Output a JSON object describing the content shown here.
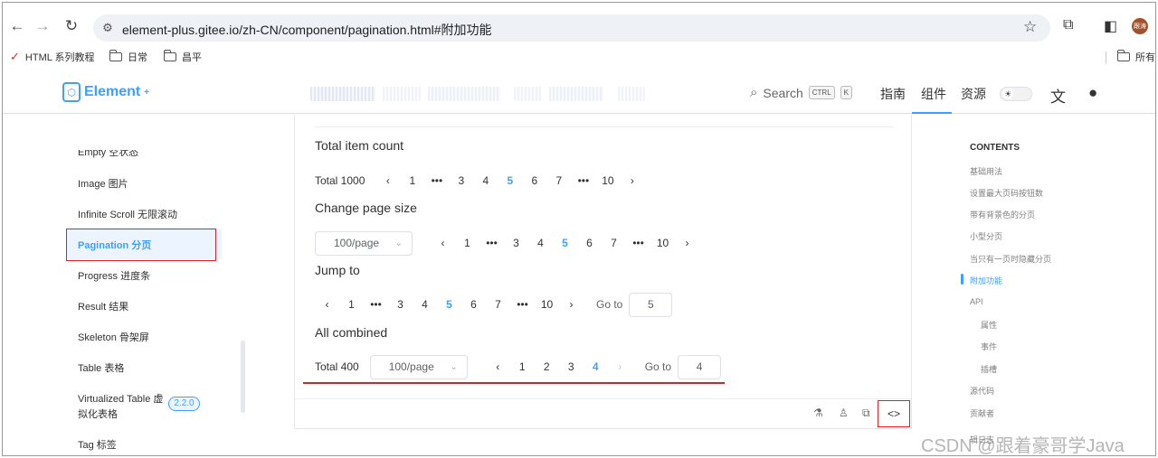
{
  "browser": {
    "url": "element-plus.gitee.io/zh-CN/component/pagination.html#附加功能",
    "profile_initials": "跟涛",
    "bookmarks": [
      {
        "label": "HTML 系列教程",
        "icon": "logo-icon"
      },
      {
        "label": "日常",
        "icon": "folder-icon"
      },
      {
        "label": "昌平",
        "icon": "folder-icon"
      }
    ],
    "bookmarks_right": "所有"
  },
  "header": {
    "logo_text": "Element",
    "logo_sup": "+",
    "search_label": "Search",
    "search_kbd_ctrl": "CTRL",
    "search_kbd_k": "K",
    "nav": [
      "指南",
      "组件",
      "资源"
    ],
    "active_nav": "组件"
  },
  "sidebar": {
    "items": [
      {
        "label": "Empty 空状态"
      },
      {
        "label": "Image 图片"
      },
      {
        "label": "Infinite Scroll 无限滚动"
      },
      {
        "label": "Pagination 分页"
      },
      {
        "label": "Progress 进度条"
      },
      {
        "label": "Result 结果"
      },
      {
        "label": "Skeleton 骨架屏"
      },
      {
        "label": "Table 表格"
      },
      {
        "label": "Virtualized Table 虚",
        "label2": "拟化表格",
        "badge": "2.2.0"
      },
      {
        "label": "Tag 标签"
      }
    ],
    "active_index": 3
  },
  "demo": {
    "sections": [
      {
        "title": "Total item count",
        "total": "Total 1000",
        "pages": [
          "1",
          "•••",
          "3",
          "4",
          "5",
          "6",
          "7",
          "•••",
          "10"
        ],
        "active": "5"
      },
      {
        "title": "Change page size",
        "page_size": "100/page",
        "pages": [
          "1",
          "•••",
          "3",
          "4",
          "5",
          "6",
          "7",
          "•••",
          "10"
        ],
        "active": "5"
      },
      {
        "title": "Jump to",
        "pages": [
          "1",
          "•••",
          "3",
          "4",
          "5",
          "6",
          "7",
          "•••",
          "10"
        ],
        "active": "5",
        "goto_label": "Go to",
        "goto_value": "5"
      },
      {
        "title": "All combined",
        "total": "Total 400",
        "page_size": "100/page",
        "pages": [
          "1",
          "2",
          "3",
          "4"
        ],
        "active": "4",
        "goto_label": "Go to",
        "goto_value": "4"
      }
    ],
    "prev_glyph": "‹",
    "next_glyph": "›",
    "footer_icons": [
      "flask-icon",
      "github-icon",
      "copy-icon",
      "code-icon"
    ]
  },
  "toc": {
    "title": "CONTENTS",
    "items": [
      {
        "label": "基础用法",
        "level": 1
      },
      {
        "label": "设置最大页码按钮数",
        "level": 1
      },
      {
        "label": "带有背景色的分页",
        "level": 1
      },
      {
        "label": "小型分页",
        "level": 1
      },
      {
        "label": "当只有一页时隐藏分页",
        "level": 1
      },
      {
        "label": "附加功能",
        "level": 1,
        "active": true
      },
      {
        "label": "API",
        "level": 1
      },
      {
        "label": "属性",
        "level": 2
      },
      {
        "label": "事件",
        "level": 2
      },
      {
        "label": "插槽",
        "level": 2
      },
      {
        "label": "源代码",
        "level": 1
      },
      {
        "label": "贡献者",
        "level": 1
      },
      {
        "label": "辑日志",
        "level": 1
      }
    ]
  },
  "watermark": "CSDN @跟着豪哥学Java",
  "colors": {
    "accent": "#409eff",
    "highlight_red": "#e02020"
  }
}
